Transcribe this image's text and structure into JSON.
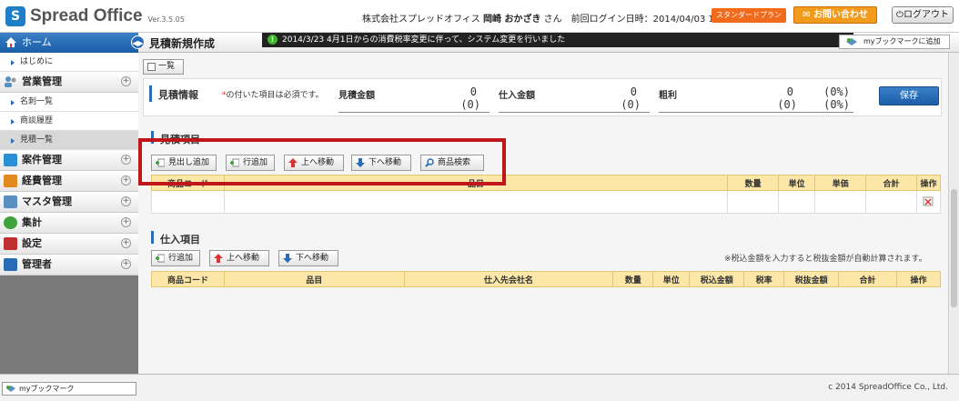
{
  "header": {
    "logo_mark": "S",
    "logo_text": "Spread Office",
    "version": "Ver.3.5.05",
    "user_info_prefix": "株式会社スプレッドオフィス",
    "user_name": "岡崎 おかざき",
    "user_suffix": "さん　前回ログイン日時：2014/04/03 10:20:34",
    "plan_badge": "スタンダードプラン",
    "contact_button": "お問い合わせ",
    "logout_button": "ログアウト"
  },
  "sidebar": {
    "home": "ホーム",
    "home_sub": "はじめに",
    "sales_group": "営業管理",
    "sales_items": [
      "名刺一覧",
      "商談履歴",
      "見積一覧"
    ],
    "groups": [
      "案件管理",
      "経費管理",
      "マスタ管理",
      "集計",
      "設定",
      "管理者"
    ],
    "group_colors": [
      "#2a8fd6",
      "#e08a1e",
      "#5a8fc4",
      "#3fa33a",
      "#c03030",
      "#2a6cb5"
    ]
  },
  "titlebar": {
    "page_title": "見積新規作成",
    "notice": "2014/3/23  4月1日からの消費税率変更に伴って、システム変更を行いました",
    "bookmark_add": "myブックマークに追加"
  },
  "toolbar": {
    "list_button": "一覧"
  },
  "info": {
    "title": "見積情報",
    "required_mark": "*",
    "required_note": "の付いた項目は必須です。",
    "estimate_label": "見積金額",
    "estimate_value": "0",
    "estimate_sub": "(0)",
    "purchase_label": "仕入金額",
    "purchase_value": "0",
    "purchase_sub": "(0)",
    "gross_label": "粗利",
    "gross_value": "0",
    "gross_sub": "(0)",
    "gross_pct": "(0%)",
    "gross_pct_sub": "(0%)",
    "save_button": "保存"
  },
  "estimate_items": {
    "title": "見積項目",
    "buttons": [
      "見出し追加",
      "行追加",
      "上へ移動",
      "下へ移動",
      "商品検索"
    ],
    "columns": [
      "商品コード",
      "品目",
      "数量",
      "単位",
      "単価",
      "合計",
      "操作"
    ]
  },
  "purchase_items": {
    "title": "仕入項目",
    "buttons": [
      "行追加",
      "上へ移動",
      "下へ移動"
    ],
    "note": "※税込金額を入力すると税抜金額が自動計算されます。",
    "columns": [
      "商品コード",
      "品目",
      "仕入先会社名",
      "数量",
      "単位",
      "税込金額",
      "税率",
      "税抜金額",
      "合計",
      "操作"
    ]
  },
  "footer": {
    "bookmark": "myブックマーク",
    "copyright": "c 2014 SpreadOffice Co., Ltd."
  }
}
